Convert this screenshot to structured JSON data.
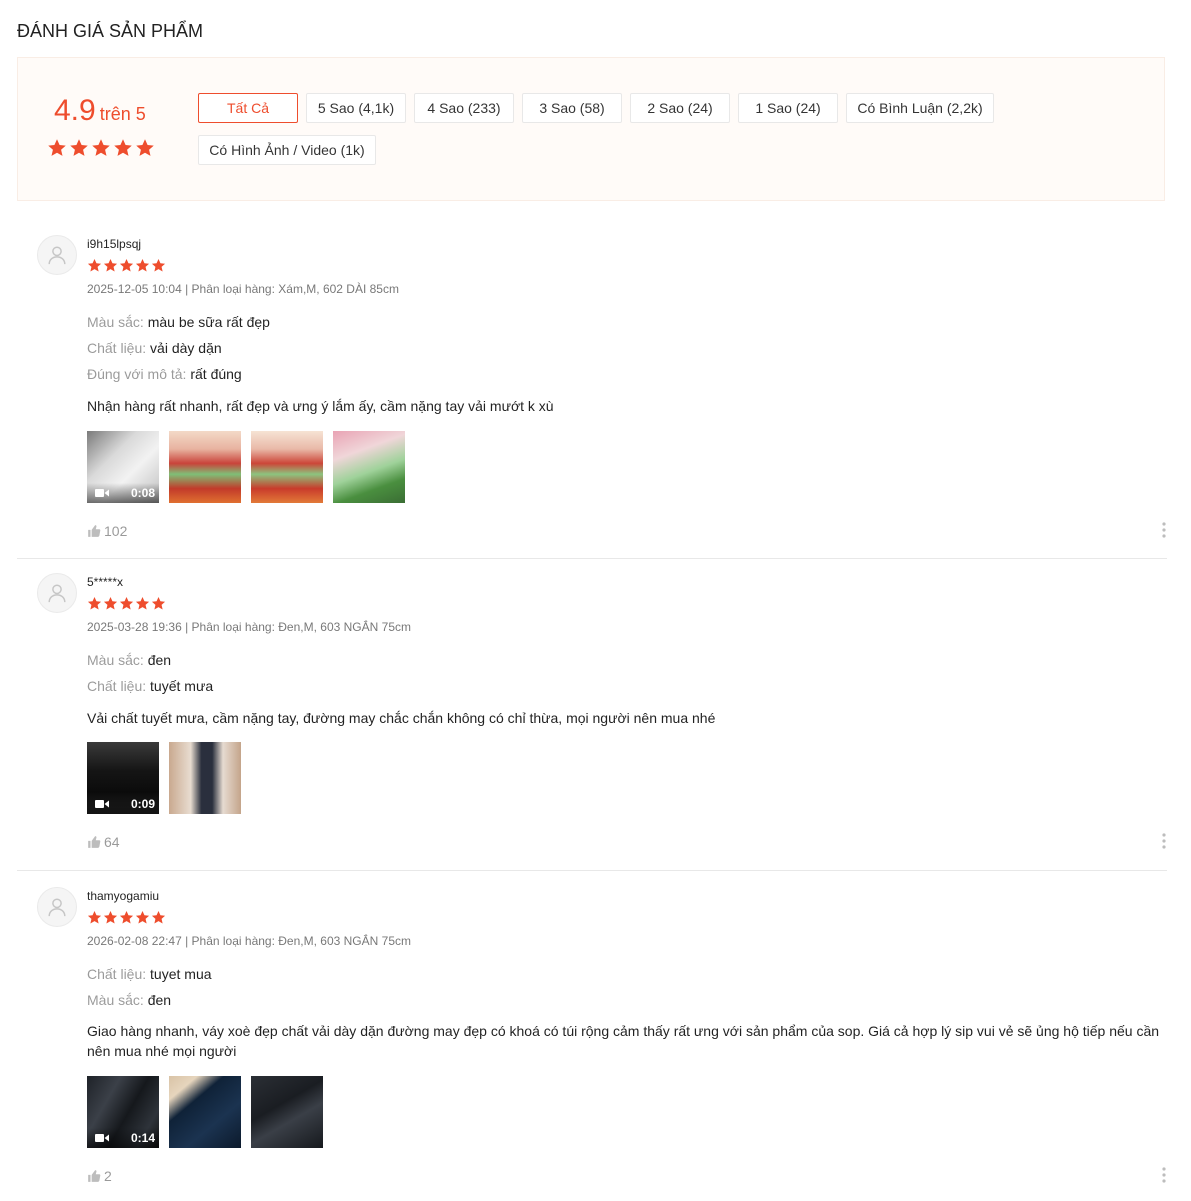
{
  "section_title": "ĐÁNH GIÁ SẢN PHẨM",
  "summary": {
    "score": "4.9",
    "score_suffix": "trên 5",
    "stars": 5
  },
  "filters": [
    {
      "label": "Tất Cả",
      "active": true
    },
    {
      "label": "5 Sao (4,1k)"
    },
    {
      "label": "4 Sao (233)"
    },
    {
      "label": "3 Sao (58)"
    },
    {
      "label": "2 Sao (24)"
    },
    {
      "label": "1 Sao (24)"
    },
    {
      "label": "Có Bình Luận (2,2k)"
    },
    {
      "label": "Có Hình Ảnh / Video (1k)"
    }
  ],
  "reviews": [
    {
      "username": "i9h15lpsqj",
      "stars": 5,
      "meta": "2025-12-05 10:04 | Phân loại hàng: Xám,M, 602 DÀI 85cm",
      "attributes": [
        {
          "key": "Màu sắc:",
          "value": "màu be sữa rất đẹp"
        },
        {
          "key": "Chất liệu:",
          "value": "vải dày dặn"
        },
        {
          "key": "Đúng với mô tả:",
          "value": "rất đúng"
        }
      ],
      "comment": "Nhận hàng rất nhanh, rất đẹp và ưng ý lắm ấy, cầm nặng tay vải mướt k xù",
      "video_duration": "0:08",
      "likes": "102"
    },
    {
      "username": "5*****x",
      "stars": 5,
      "meta": "2025-03-28 19:36 | Phân loại hàng: Đen,M, 603 NGẮN 75cm",
      "attributes": [
        {
          "key": "Màu sắc:",
          "value": "đen"
        },
        {
          "key": "Chất liệu:",
          "value": "tuyết mưa"
        }
      ],
      "comment": "Vải chất tuyết mưa, cầm nặng tay, đường may chắc chắn không có chỉ thừa, mọi người nên mua nhé",
      "video_duration": "0:09",
      "likes": "64"
    },
    {
      "username": "thamyogamiu",
      "stars": 5,
      "meta": "2026-02-08 22:47 | Phân loại hàng: Đen,M, 603 NGẮN 75cm",
      "attributes": [
        {
          "key": "Chất liệu:",
          "value": "tuyet mua"
        },
        {
          "key": "Màu sắc:",
          "value": "đen"
        }
      ],
      "comment": "Giao hàng nhanh, váy xoè đẹp chất vải dày dặn đường may đẹp có khoá có túi rộng cảm thấy rất ưng với sản phẩm của sop. Giá cả hợp lý sip vui vẻ sẽ ủng hộ tiếp nếu cần nên mua nhé mọi người",
      "video_duration": "0:14",
      "likes": "2"
    }
  ],
  "colors": {
    "accent": "#ee4d2d",
    "overview_bg": "#fffbf8"
  }
}
